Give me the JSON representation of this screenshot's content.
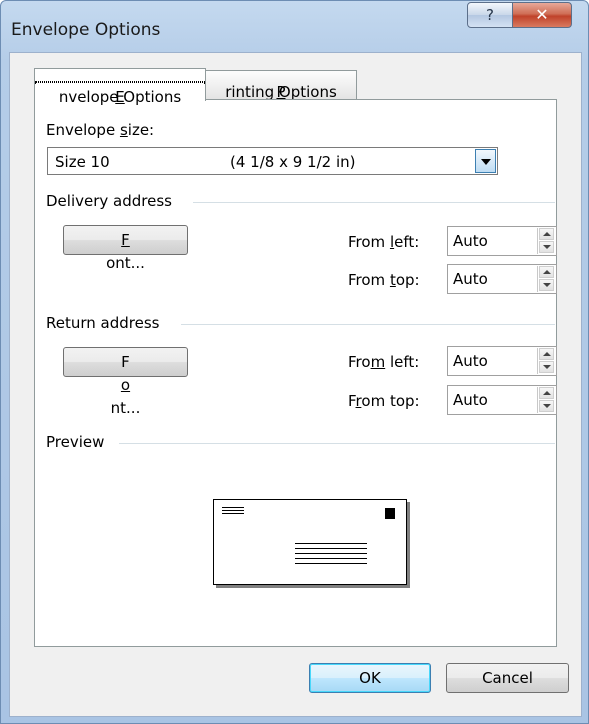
{
  "window": {
    "title": "Envelope Options",
    "help_icon": "question-mark",
    "close_icon": "x"
  },
  "tabs": [
    {
      "label": "Envelope Options",
      "mnemonic": "E",
      "active": true
    },
    {
      "label": "Printing Options",
      "mnemonic": "P",
      "active": false
    }
  ],
  "envelope_size": {
    "label": "Envelope size:",
    "label_pre": "Envelope ",
    "label_mn": "s",
    "label_post": "ize:",
    "value_name": "Size 10",
    "value_dims": "(4 1/8 x 9 1/2 in)"
  },
  "delivery": {
    "heading": "Delivery address",
    "font_button": {
      "pre": "",
      "mn": "F",
      "post": "ont..."
    },
    "from_left": {
      "pre": "From ",
      "mn": "l",
      "post": "eft:",
      "value": "Auto"
    },
    "from_top": {
      "pre": "From ",
      "mn": "t",
      "post": "op:",
      "value": "Auto"
    }
  },
  "return": {
    "heading": "Return address",
    "font_button": {
      "pre": "F",
      "mn": "o",
      "post": "nt..."
    },
    "from_left": {
      "pre": "Fro",
      "mn": "m",
      "post": " left:",
      "value": "Auto"
    },
    "from_top": {
      "pre": "F",
      "mn": "r",
      "post": "om top:",
      "value": "Auto"
    }
  },
  "preview": {
    "heading": "Preview"
  },
  "buttons": {
    "ok": "OK",
    "cancel": "Cancel"
  }
}
